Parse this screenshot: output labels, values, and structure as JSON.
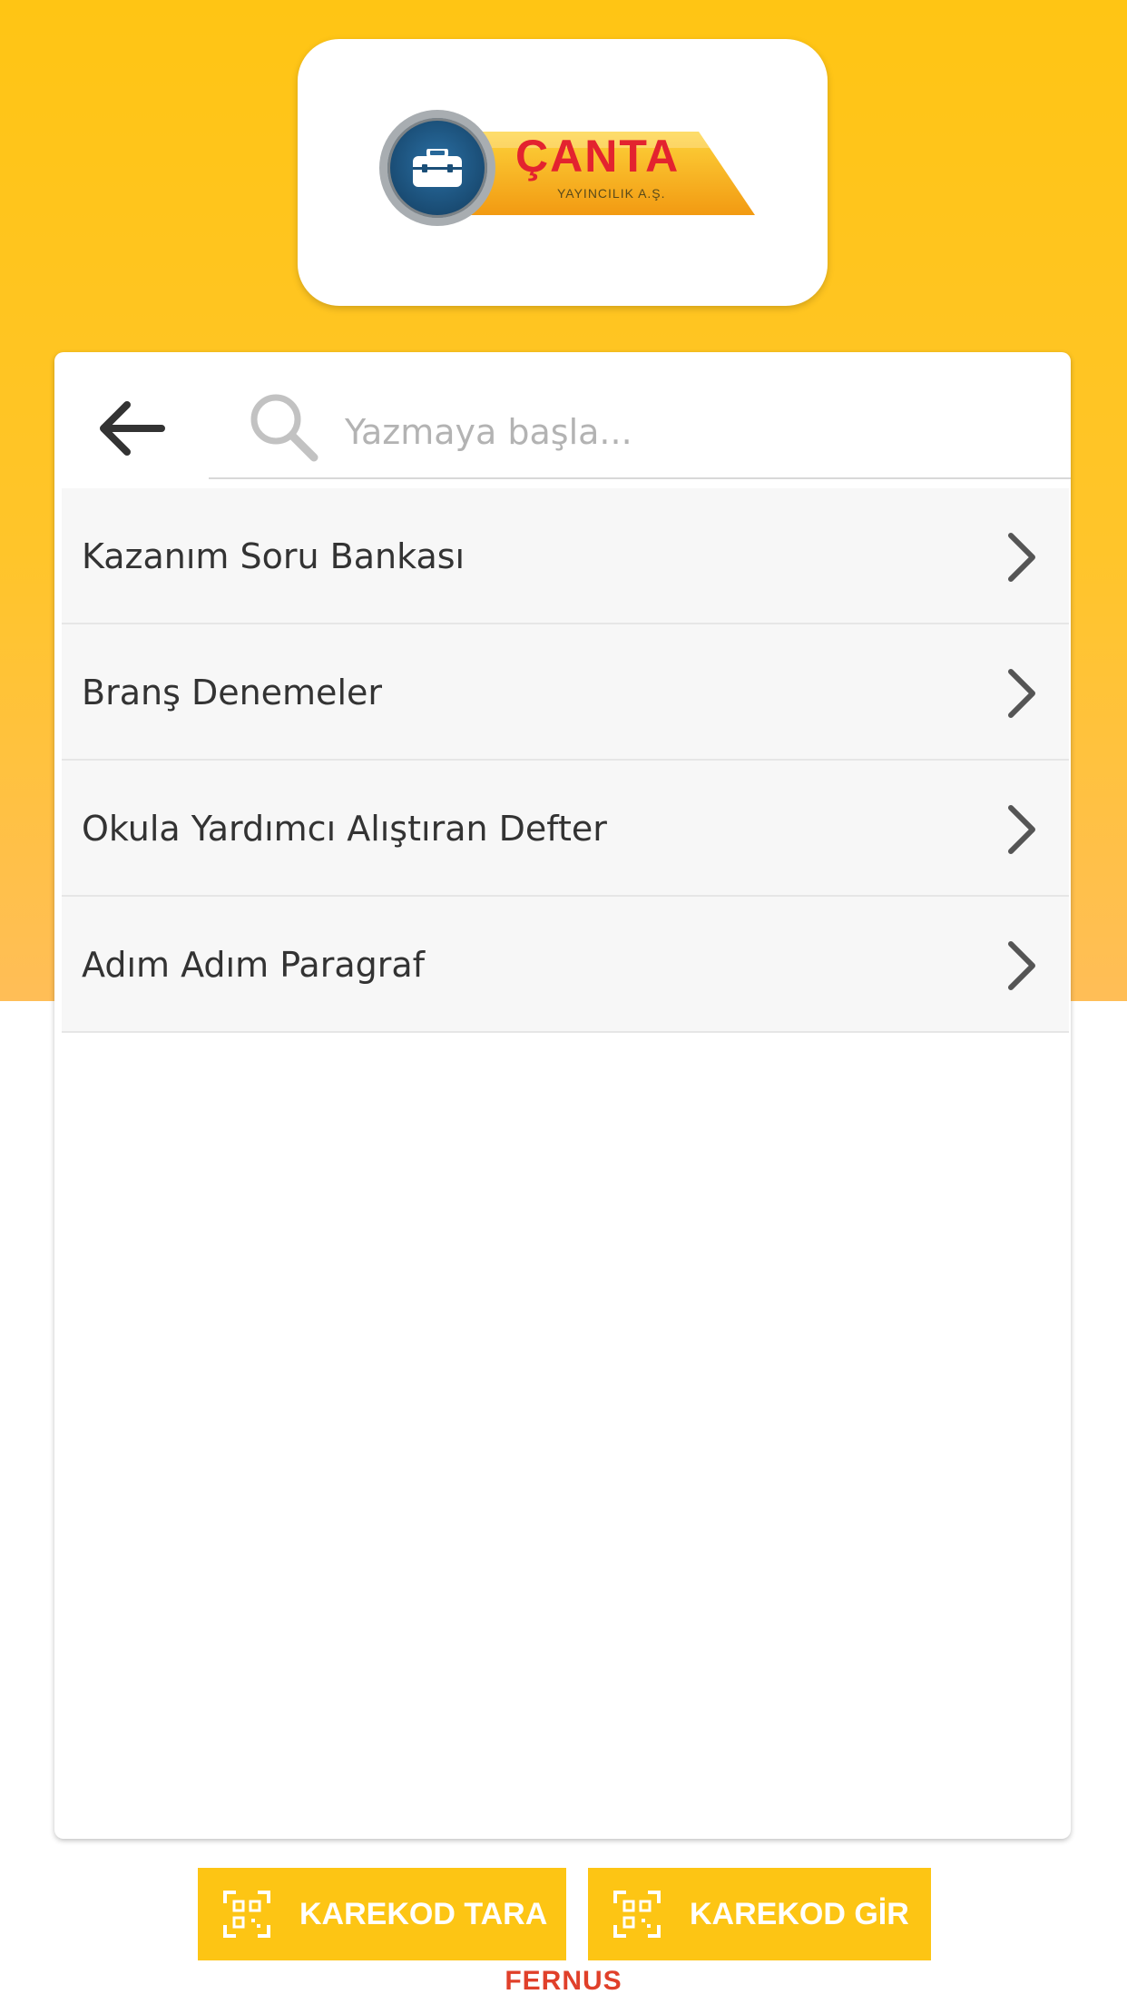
{
  "brand": {
    "logo_text": "ÇANTA",
    "logo_subtext": "YAYINCILIK A.Ş.",
    "logo_colors": {
      "red": "#e3232f",
      "orange": "#f4a91c",
      "blue": "#1b4f78"
    }
  },
  "search": {
    "placeholder": "Yazmaya başla...",
    "value": ""
  },
  "list": {
    "items": [
      {
        "label": "Kazanım Soru Bankası"
      },
      {
        "label": "Branş Denemeler"
      },
      {
        "label": "Okula Yardımcı Alıştıran Defter"
      },
      {
        "label": "Adım Adım Paragraf"
      }
    ]
  },
  "actions": {
    "scan_label": "KAREKOD TARA",
    "enter_label": "KAREKOD GİR"
  },
  "footer": {
    "brand": "FERNUS"
  },
  "colors": {
    "accent": "#fdc514",
    "footer_brand": "#e0402a"
  }
}
